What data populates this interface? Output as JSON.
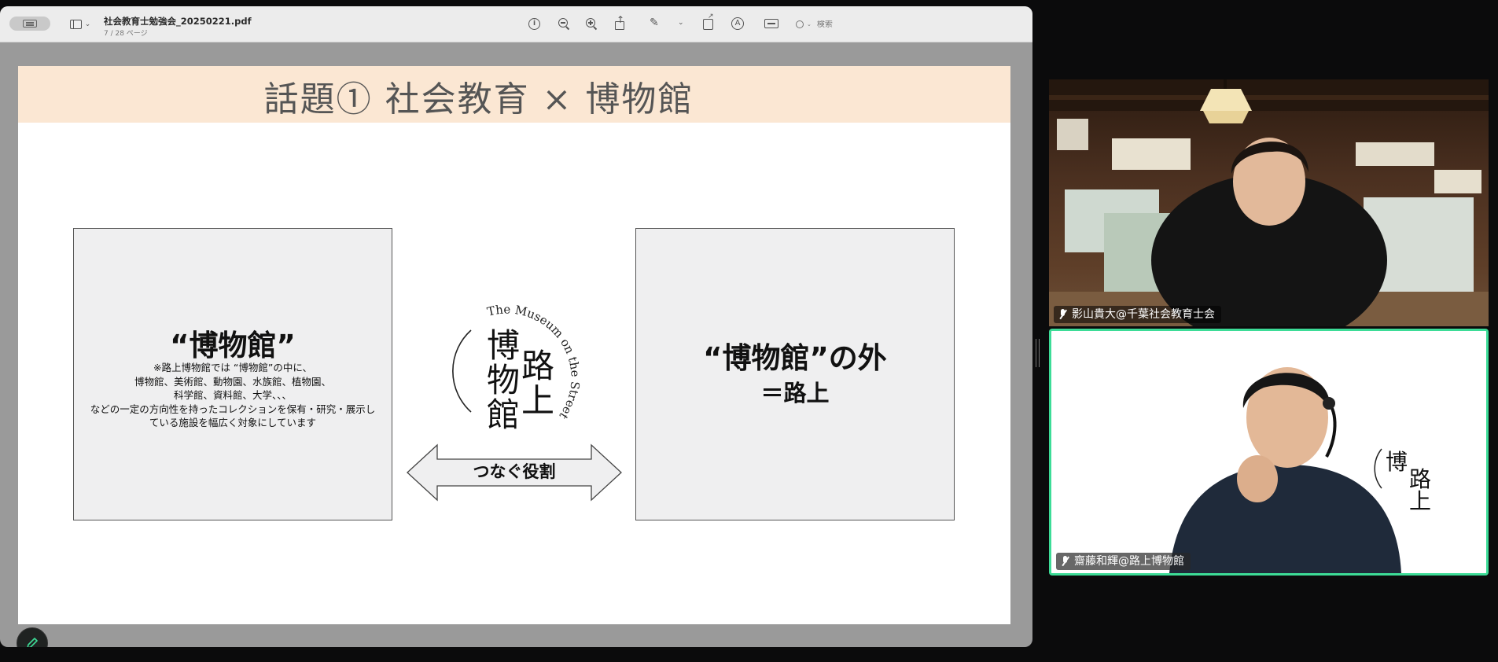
{
  "viewer": {
    "doc_title": "社会教育士勉強会_20250221.pdf",
    "page_info": "7 / 28 ページ",
    "search_placeholder": "検索",
    "view_chevron": "⌄",
    "markup_chevron": "⌄",
    "info_glyph": "i",
    "markup_glyph": "A"
  },
  "slide": {
    "title": "話題① 社会教育 × 博物館",
    "left_box": {
      "heading": "“博物館”",
      "note": [
        "※路上博物館では “博物館”の中に、",
        "博物館、美術館、動物園、水族館、植物園、",
        "科学館、資料館、大学、、、",
        "などの一定の方向性を持ったコレクションを保有・研究・展示し",
        "ている施設を幅広く対象にしています"
      ]
    },
    "right_box": {
      "heading": "“博物館”の外",
      "sub": "＝路上"
    },
    "connector_label": "つなぐ役割",
    "logo": {
      "arc_text": "The Museum on the Street",
      "col_right": [
        "路",
        "上"
      ],
      "col_left": [
        "博",
        "物",
        "館"
      ]
    }
  },
  "participants": [
    {
      "name": "影山貴大@千葉社会教育士会"
    },
    {
      "name": "齋藤和輝@路上博物館"
    }
  ],
  "colors": {
    "header_band": "#fbe7d3",
    "active_speaker": "#3ddc97"
  }
}
